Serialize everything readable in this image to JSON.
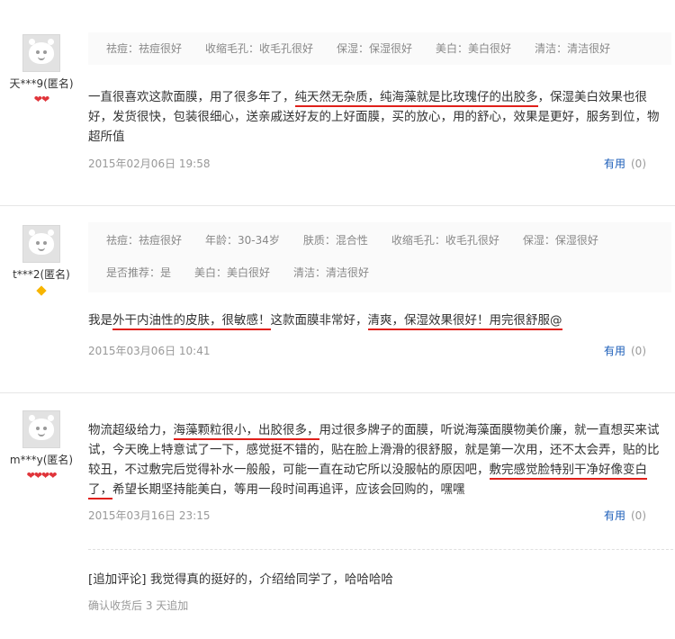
{
  "reviews": [
    {
      "username": "天***9(匿名)",
      "level_icon": "heart",
      "level_count": 2,
      "tags": [
        "祛痘：祛痘很好",
        "收缩毛孔：收毛孔很好",
        "保湿：保湿很好",
        "美白：美白很好",
        "清洁：清洁很好"
      ],
      "text_parts": [
        {
          "t": "一直很喜欢这款面膜，用了很多年了，",
          "hl": false
        },
        {
          "t": "纯天然无杂质，纯海藻就是比玫瑰仔的出胶多",
          "hl": true
        },
        {
          "t": "，保湿美白效果也很好，发货很快，包装很细心，送亲戚送好友的上好面膜，买的放心，用的舒心，效果是更好，服务到位，物超所值",
          "hl": false
        }
      ],
      "date": "2015年02月06日 19:58",
      "useful_label": "有用",
      "useful_count": "(0)"
    },
    {
      "username": "t***2(匿名)",
      "level_icon": "diamond",
      "level_count": 1,
      "tags_row1": [
        "祛痘：祛痘很好",
        "年龄：30-34岁",
        "肤质：混合性",
        "收缩毛孔：收毛孔很好",
        "保湿：保湿很好"
      ],
      "tags_row2": [
        "是否推荐：是",
        "美白：美白很好",
        "清洁：清洁很好"
      ],
      "text_parts": [
        {
          "t": "我是",
          "hl": false
        },
        {
          "t": "外干内油性的皮肤，很敏感！",
          "hl": true
        },
        {
          "t": "这款面膜非常好，",
          "hl": false
        },
        {
          "t": "清爽，保湿效果很好！用完很舒服@",
          "hl": true
        }
      ],
      "date": "2015年03月06日 10:41",
      "useful_label": "有用",
      "useful_count": "(0)"
    },
    {
      "username": "m***y(匿名)",
      "level_icon": "heart",
      "level_count": 4,
      "text_parts": [
        {
          "t": "物流超级给力，",
          "hl": false
        },
        {
          "t": "海藻颗粒很小，出胶很多，",
          "hl": true
        },
        {
          "t": "用过很多牌子的面膜，听说海藻面膜物美价廉，就一直想买来试试，今天晚上特意试了一下，感觉挺不错的，贴在脸上滑滑的很舒服，就是第一次用，还不太会弄，贴的比较丑，不过敷完后觉得补水一般般，可能一直在动它所以没服帖的原因吧，",
          "hl": false
        },
        {
          "t": "敷完感觉脸特别干净好像变白了，",
          "hl": true
        },
        {
          "t": "希望长期坚持能美白，等用一段时间再追评，应该会回购的，嘿嘿",
          "hl": false
        }
      ],
      "date": "2015年03月16日 23:15",
      "useful_label": "有用",
      "useful_count": "(0)",
      "append_text": "[追加评论] 我觉得真的挺好的，介绍给同学了，哈哈哈哈",
      "append_note": "确认收货后 3 天追加"
    }
  ],
  "colors": {
    "highlight_underline": "#e0201a",
    "link": "#1a5cb8",
    "meta": "#999999"
  }
}
